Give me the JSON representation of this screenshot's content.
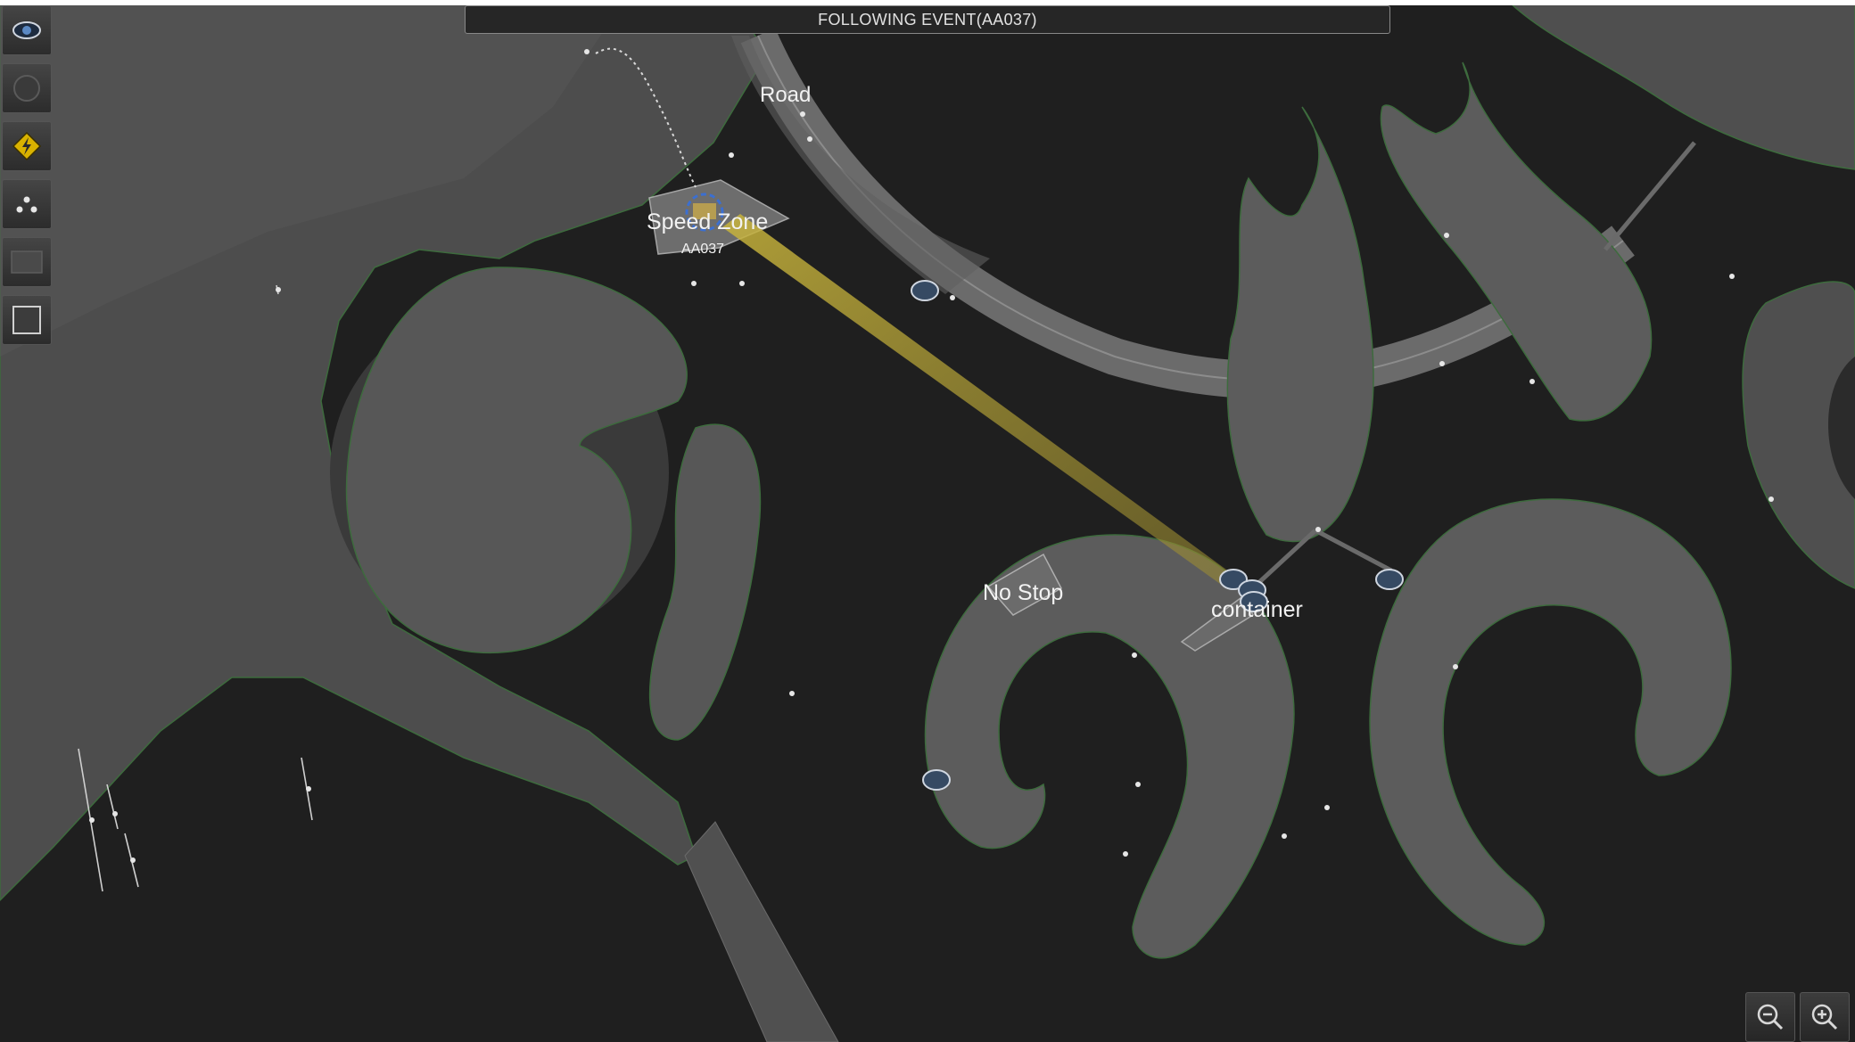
{
  "event_bar": {
    "title": "FOLLOWING EVENT(AA037)"
  },
  "map": {
    "zone_labels": {
      "road": "Road",
      "speed_zone": "Speed Zone",
      "no_stop": "No Stop",
      "container": "container"
    },
    "tracked_vehicle": {
      "id": "AA037"
    }
  },
  "toolbar": {
    "tools": [
      "camera-eye-icon",
      "circle-icon",
      "alert-bolt-icon",
      "cluster-dots-icon",
      "rectangle-icon",
      "square-icon"
    ]
  },
  "zoom": {
    "controls": [
      "zoom-out-icon",
      "zoom-in-icon"
    ]
  },
  "colors": {
    "water": "#1f1f1f",
    "land": "#4a4a4a",
    "island": "#5c5c5c",
    "highlight_beam": "#b3a23a",
    "accent_alert": "#d9b200"
  }
}
